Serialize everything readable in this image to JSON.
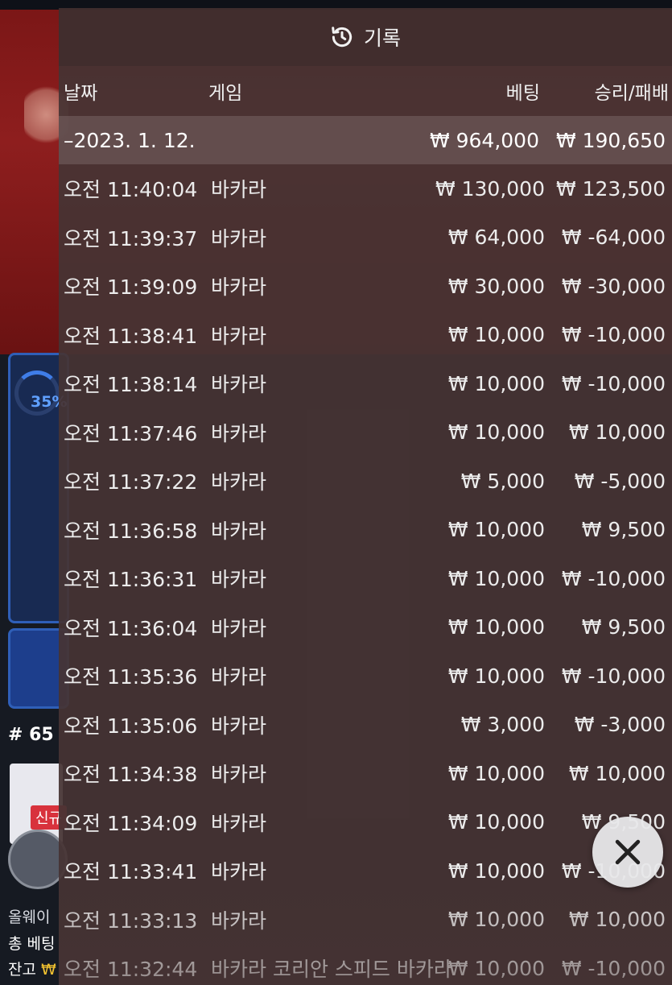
{
  "background": {
    "percent": "35%",
    "round_label": "# 65",
    "tag_label": "신규",
    "line1": "올웨이",
    "line2": "총 베팅",
    "line3_label": "잔고",
    "line3_currency": "₩"
  },
  "header": {
    "icon": "history-icon",
    "title": "기록"
  },
  "columns": {
    "date": "날짜",
    "game": "게임",
    "bet": "베팅",
    "result": "승리/패배"
  },
  "date_group": {
    "label": "–2023. 1. 12.",
    "bet": "₩ 964,000",
    "result": "₩ 190,650"
  },
  "rows": [
    {
      "time": "오전 11:40:04",
      "game": "바카라",
      "bet": "₩ 130,000",
      "result": "₩ 123,500"
    },
    {
      "time": "오전 11:39:37",
      "game": "바카라",
      "bet": "₩ 64,000",
      "result": "₩ -64,000"
    },
    {
      "time": "오전 11:39:09",
      "game": "바카라",
      "bet": "₩ 30,000",
      "result": "₩ -30,000"
    },
    {
      "time": "오전 11:38:41",
      "game": "바카라",
      "bet": "₩ 10,000",
      "result": "₩ -10,000"
    },
    {
      "time": "오전 11:38:14",
      "game": "바카라",
      "bet": "₩ 10,000",
      "result": "₩ -10,000"
    },
    {
      "time": "오전 11:37:46",
      "game": "바카라",
      "bet": "₩ 10,000",
      "result": "₩ 10,000"
    },
    {
      "time": "오전 11:37:22",
      "game": "바카라",
      "bet": "₩ 5,000",
      "result": "₩ -5,000"
    },
    {
      "time": "오전 11:36:58",
      "game": "바카라",
      "bet": "₩ 10,000",
      "result": "₩ 9,500"
    },
    {
      "time": "오전 11:36:31",
      "game": "바카라",
      "bet": "₩ 10,000",
      "result": "₩ -10,000"
    },
    {
      "time": "오전 11:36:04",
      "game": "바카라",
      "bet": "₩ 10,000",
      "result": "₩ 9,500"
    },
    {
      "time": "오전 11:35:36",
      "game": "바카라",
      "bet": "₩ 10,000",
      "result": "₩ -10,000"
    },
    {
      "time": "오전 11:35:06",
      "game": "바카라",
      "bet": "₩ 3,000",
      "result": "₩ -3,000"
    },
    {
      "time": "오전 11:34:38",
      "game": "바카라",
      "bet": "₩ 10,000",
      "result": "₩ 10,000"
    },
    {
      "time": "오전 11:34:09",
      "game": "바카라",
      "bet": "₩ 10,000",
      "result": "₩ 9,500"
    },
    {
      "time": "오전 11:33:41",
      "game": "바카라",
      "bet": "₩ 10,000",
      "result": "₩ -10,000"
    },
    {
      "time": "오전 11:33:13",
      "game": "바카라",
      "bet": "₩ 10,000",
      "result": "₩ 10,000"
    },
    {
      "time": "오전 11:32:44",
      "game": "바카라 코리안 스피드 바카라",
      "bet": "₩ 10,000",
      "result": "₩ -10,000"
    }
  ],
  "close_button": {
    "icon": "close-icon"
  }
}
